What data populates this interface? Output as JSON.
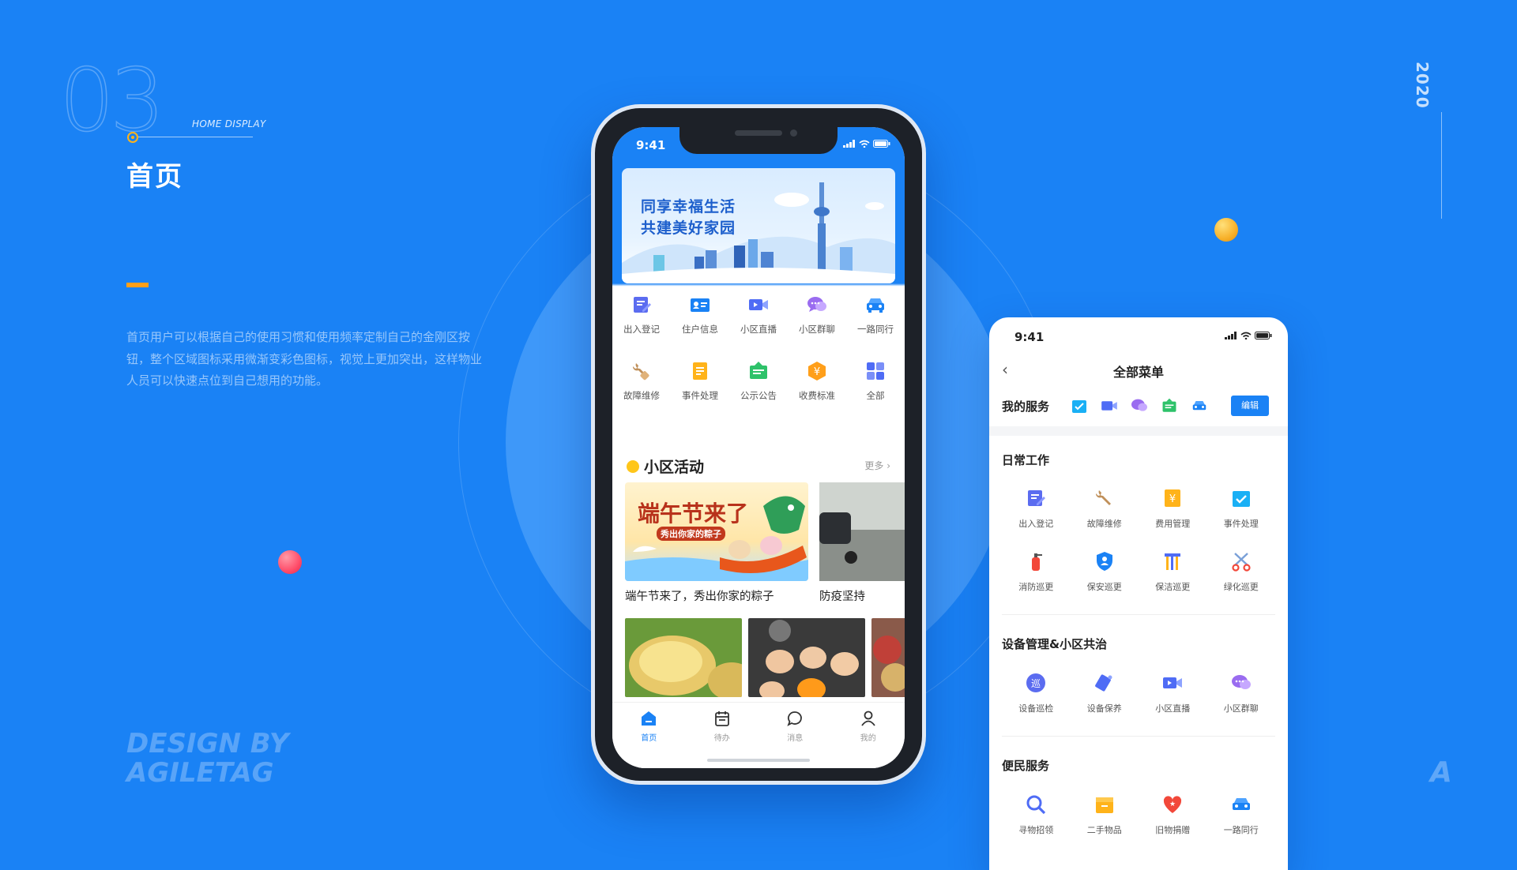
{
  "presentation": {
    "section_number": "03",
    "section_en": "HOME DISPLAY",
    "title": "首页",
    "description": "首页用户可以根据自己的使用习惯和使用频率定制自己的金刚区按钮，整个区域图标采用微渐变彩色图标，视觉上更加突出，这样物业人员可以快速点位到自己想用的功能。",
    "credit_line1": "DESIGN BY",
    "credit_line2": "AGILETAG",
    "year": "2020",
    "logo_letter": "A"
  },
  "phone_home": {
    "status_time": "9:41",
    "banner": {
      "line1": "同享幸福生活",
      "line2": "共建美好家园"
    },
    "grid_row1": [
      {
        "label": "出入登记",
        "icon": "edit-doc-icon",
        "color": "#5b6cf0"
      },
      {
        "label": "住户信息",
        "icon": "id-card-icon",
        "color": "#1a82f5"
      },
      {
        "label": "小区直播",
        "icon": "video-icon",
        "color": "#4f6cf5"
      },
      {
        "label": "小区群聊",
        "icon": "chat-icon",
        "color": "#9a6cf0"
      },
      {
        "label": "一路同行",
        "icon": "car-icon",
        "color": "#1a82f5"
      }
    ],
    "grid_row2": [
      {
        "label": "故障维修",
        "icon": "wrench-icon",
        "color": "#c0905a"
      },
      {
        "label": "事件处理",
        "icon": "event-doc-icon",
        "color": "#ffb31a"
      },
      {
        "label": "公示公告",
        "icon": "notice-board-icon",
        "color": "#2ec26a"
      },
      {
        "label": "收费标准",
        "icon": "yuan-coin-icon",
        "color": "#ff9f1a"
      },
      {
        "label": "全部",
        "icon": "all-grid-icon",
        "color": "#4f6cf5"
      }
    ],
    "activity_title": "小区活动",
    "activity_more": "更多",
    "card1_art_title": "端午节来了",
    "card1_art_sub": "秀出你家的粽子",
    "card1_caption": "端午节来了，秀出你家的粽子",
    "card2_caption": "防疫坚持",
    "tabs": [
      {
        "label": "首页",
        "icon": "home-icon",
        "active": true
      },
      {
        "label": "待办",
        "icon": "calendar-icon",
        "active": false
      },
      {
        "label": "消息",
        "icon": "message-icon",
        "active": false
      },
      {
        "label": "我的",
        "icon": "user-icon",
        "active": false
      }
    ]
  },
  "phone_menu": {
    "status_time": "9:41",
    "title": "全部菜单",
    "my_services_label": "我的服务",
    "my_services_icons": [
      "checklist-icon",
      "video-icon",
      "chat-icon",
      "notice-board-icon",
      "car-icon"
    ],
    "edit_label": "编辑",
    "sections": [
      {
        "title": "日常工作",
        "rows": [
          [
            {
              "label": "出入登记",
              "icon": "edit-doc-icon"
            },
            {
              "label": "故障维修",
              "icon": "wrench-icon"
            },
            {
              "label": "费用管理",
              "icon": "yuan-doc-icon"
            },
            {
              "label": "事件处理",
              "icon": "checklist-icon"
            }
          ],
          [
            {
              "label": "消防巡更",
              "icon": "extinguisher-icon"
            },
            {
              "label": "保安巡更",
              "icon": "shield-user-icon"
            },
            {
              "label": "保洁巡更",
              "icon": "cleaning-icon"
            },
            {
              "label": "绿化巡更",
              "icon": "scissors-icon"
            }
          ]
        ]
      },
      {
        "title": "设备管理&小区共治",
        "rows": [
          [
            {
              "label": "设备巡检",
              "icon": "patrol-icon"
            },
            {
              "label": "设备保养",
              "icon": "device-tag-icon"
            },
            {
              "label": "小区直播",
              "icon": "video-icon"
            },
            {
              "label": "小区群聊",
              "icon": "chat-icon"
            }
          ]
        ]
      },
      {
        "title": "便民服务",
        "rows": [
          [
            {
              "label": "寻物招领",
              "icon": "search-icon"
            },
            {
              "label": "二手物品",
              "icon": "box-icon"
            },
            {
              "label": "旧物捐赠",
              "icon": "heart-icon"
            },
            {
              "label": "一路同行",
              "icon": "car-icon"
            }
          ]
        ]
      }
    ]
  }
}
